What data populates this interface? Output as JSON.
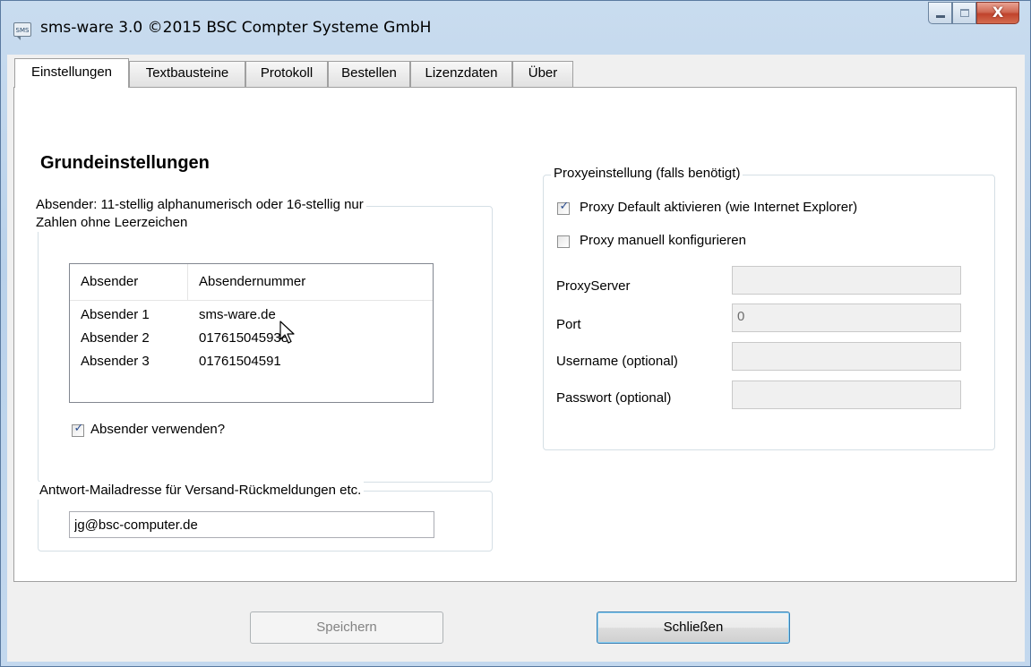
{
  "window": {
    "title": "sms-ware 3.0 ©2015 BSC Compter Systeme GmbH",
    "icon_label": "SMS",
    "close_glyph": "X"
  },
  "tabs": [
    {
      "label": "Einstellungen",
      "active": true
    },
    {
      "label": "Textbausteine",
      "active": false
    },
    {
      "label": "Protokoll",
      "active": false
    },
    {
      "label": "Bestellen",
      "active": false
    },
    {
      "label": "Lizenzdaten",
      "active": false
    },
    {
      "label": "Über",
      "active": false
    }
  ],
  "settings": {
    "heading": "Grundeinstellungen",
    "sender_group": {
      "legend_line1": "Absender: 11-stellig alphanumerisch oder 16-stellig nur",
      "legend_line2": "Zahlen ohne Leerzeichen",
      "columns": [
        "Absender",
        "Absendernummer"
      ],
      "rows": [
        {
          "name": "Absender 1",
          "number": "sms-ware.de"
        },
        {
          "name": "Absender 2",
          "number": "017615045938"
        },
        {
          "name": "Absender 3",
          "number": "01761504591"
        }
      ],
      "use_sender_label": "Absender verwenden?",
      "use_sender_checked": true
    },
    "reply_group": {
      "legend": "Antwort-Mailadresse für Versand-Rückmeldungen etc.",
      "email_value": "jg@bsc-computer.de"
    },
    "proxy_group": {
      "legend": "Proxyeinstellung (falls benötigt)",
      "default_label": "Proxy Default aktivieren (wie Internet Explorer)",
      "default_checked": true,
      "manual_label": "Proxy manuell konfigurieren",
      "manual_checked": false,
      "server_label": "ProxyServer",
      "server_value": "",
      "port_label": "Port",
      "port_value": "0",
      "username_label": "Username (optional)",
      "username_value": "",
      "password_label": "Passwort (optional)",
      "password_value": ""
    }
  },
  "footer": {
    "save_label": "Speichern",
    "close_label": "Schließen"
  },
  "colors": {
    "title_gradient": "#b9d1ea",
    "close_button": "#c0432c",
    "checkmark": "#2a4d8f"
  }
}
